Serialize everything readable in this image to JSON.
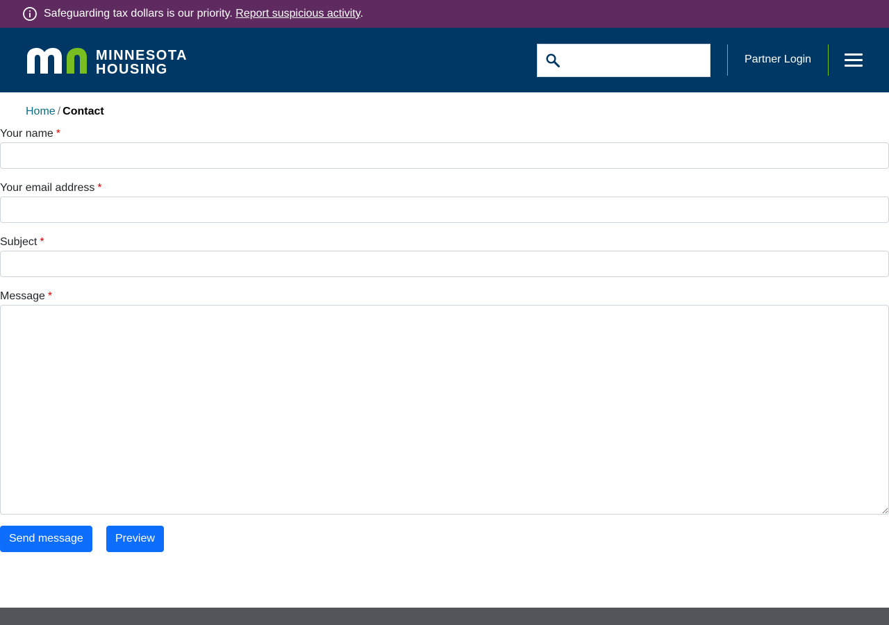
{
  "alert": {
    "icon": "info-icon",
    "text": "Safeguarding tax dollars is our priority. ",
    "link_text": "Report suspicious activity",
    "suffix": ".",
    "background": "#5e2a5f"
  },
  "header": {
    "logo": {
      "mark": "mn-logo-icon",
      "line1": "MINNESOTA",
      "line2": "HOUSING"
    },
    "search": {
      "icon": "search-icon",
      "value": "",
      "placeholder": ""
    },
    "partner_login": "Partner Login",
    "menu_icon": "hamburger-menu-icon",
    "background": "#003865",
    "accent": "#78be21"
  },
  "breadcrumb": {
    "items": [
      {
        "label": "Home"
      }
    ],
    "separator": "/",
    "current": "Contact"
  },
  "form": {
    "required_mark": "*",
    "fields": {
      "name": {
        "label": "Your name",
        "value": ""
      },
      "email": {
        "label": "Your email address",
        "value": ""
      },
      "subject": {
        "label": "Subject",
        "value": ""
      },
      "message": {
        "label": "Message",
        "value": ""
      }
    },
    "send_label": "Send message",
    "preview_label": "Preview",
    "button_color": "#0d6efd"
  },
  "footer": {
    "background": "#53565a"
  }
}
